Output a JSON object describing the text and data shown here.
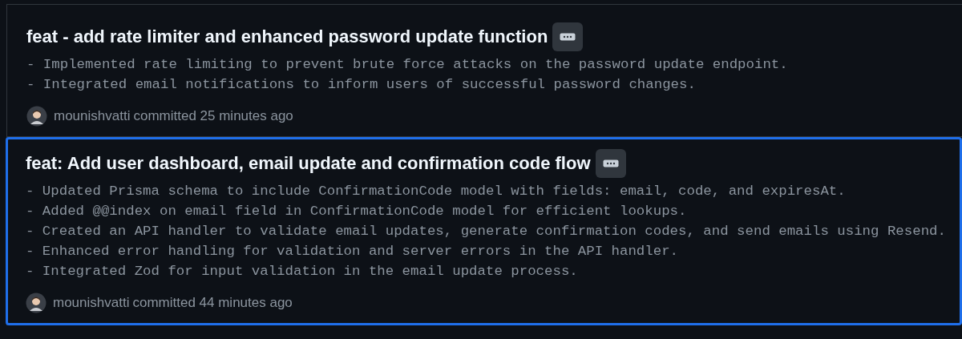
{
  "commits": [
    {
      "title": "feat - add rate limiter and enhanced password update function",
      "selected": false,
      "body": [
        "- Implemented rate limiting to prevent brute force attacks on the password update endpoint.",
        "- Integrated email notifications to inform users of successful password changes."
      ],
      "author": "mounishvatti",
      "meta": "committed 25 minutes ago"
    },
    {
      "title": "feat: Add user dashboard, email update and confirmation code flow",
      "selected": true,
      "body": [
        "- Updated Prisma schema to include ConfirmationCode model with fields: email, code, and expiresAt.",
        "- Added @@index on email field in ConfirmationCode model for efficient lookups.",
        "- Created an API handler to validate email updates, generate confirmation codes, and send emails using Resend.",
        "- Enhanced error handling for validation and server errors in the API handler.",
        "- Integrated Zod for input validation in the email update process."
      ],
      "author": "mounishvatti",
      "meta": "committed 44 minutes ago"
    }
  ]
}
